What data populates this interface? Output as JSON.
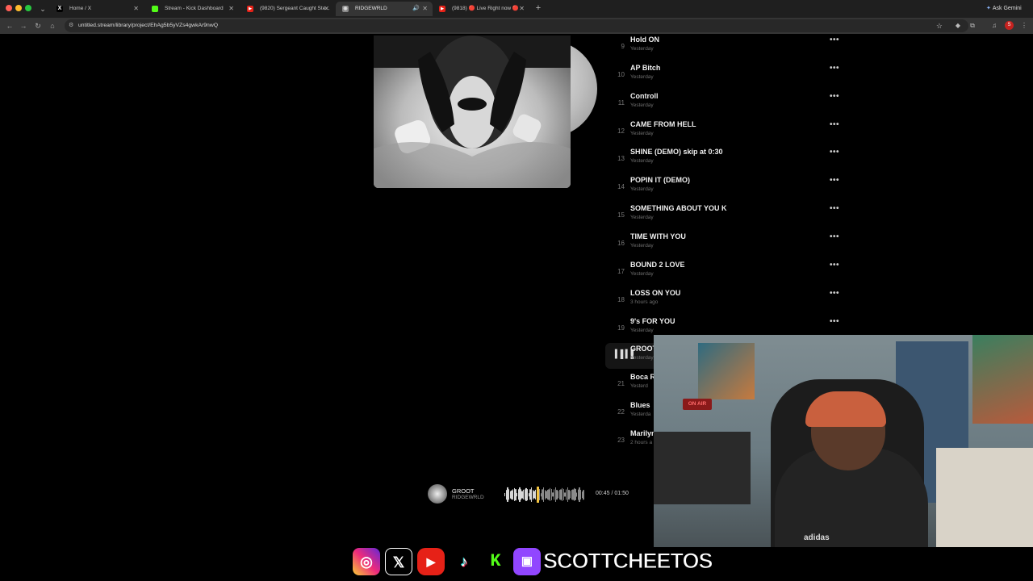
{
  "browser": {
    "tabs": [
      {
        "title": "Home / X",
        "fav": "X",
        "fav_color": "#000000",
        "active": false
      },
      {
        "title": "Stream - Kick Dashboard",
        "fav": "K",
        "fav_color": "#53fc18",
        "active": false
      },
      {
        "title": "(9820) Sergeant Caught Ste...",
        "fav": "▶",
        "fav_color": "#e62117",
        "active": false
      },
      {
        "title": "RIDGEWRLD",
        "fav": "◉",
        "fav_color": "#888888",
        "active": true
      },
      {
        "title": "(9818) 🔴 Live Right now 🔴",
        "fav": "▶",
        "fav_color": "#e62117",
        "active": false
      }
    ],
    "ask_gemini": "Ask Gemini",
    "url": "untitled.stream/library/project/EhAg5b5yVZs4gwkAr9nwQ",
    "profile_badge": "S"
  },
  "tracks": [
    {
      "num": "9",
      "title": "Hold ON",
      "meta": "Yesterday"
    },
    {
      "num": "10",
      "title": "AP Bitch",
      "meta": "Yesterday"
    },
    {
      "num": "11",
      "title": "Controll",
      "meta": "Yesterday"
    },
    {
      "num": "12",
      "title": "CAME FROM HELL",
      "meta": "Yesterday"
    },
    {
      "num": "13",
      "title": "SHINE (DEMO) skip at 0:30",
      "meta": "Yesterday"
    },
    {
      "num": "14",
      "title": "POPIN IT (DEMO)",
      "meta": "Yesterday"
    },
    {
      "num": "15",
      "title": "SOMETHING ABOUT YOU K",
      "meta": "Yesterday"
    },
    {
      "num": "16",
      "title": "TIME WITH YOU",
      "meta": "Yesterday"
    },
    {
      "num": "17",
      "title": "BOUND 2 LOVE",
      "meta": "Yesterday"
    },
    {
      "num": "18",
      "title": "LOSS ON YOU",
      "meta": "3 hours ago"
    },
    {
      "num": "19",
      "title": "9's FOR YOU",
      "meta": "Yesterday"
    },
    {
      "num": "20",
      "title": "GROOT",
      "meta": "Yesterday",
      "playing": true
    },
    {
      "num": "21",
      "title": "Boca R",
      "meta": "Yesterd"
    },
    {
      "num": "22",
      "title": "Blues",
      "meta": "Yesterda"
    },
    {
      "num": "23",
      "title": "Marilyn",
      "meta": "2 hours a"
    }
  ],
  "player": {
    "title": "GROOT",
    "artist": "RIDGEWRLD",
    "time": "00:45 / 01:50",
    "progress": 0.41
  },
  "webcam": {
    "on_air": "ON AIR",
    "shirt_logo": "adidas"
  },
  "socials": {
    "icons": [
      "instagram-icon",
      "x-icon",
      "youtube-icon",
      "tiktok-icon",
      "kick-icon",
      "twitch-icon"
    ],
    "handle": "SCOTTCHEETOS"
  }
}
